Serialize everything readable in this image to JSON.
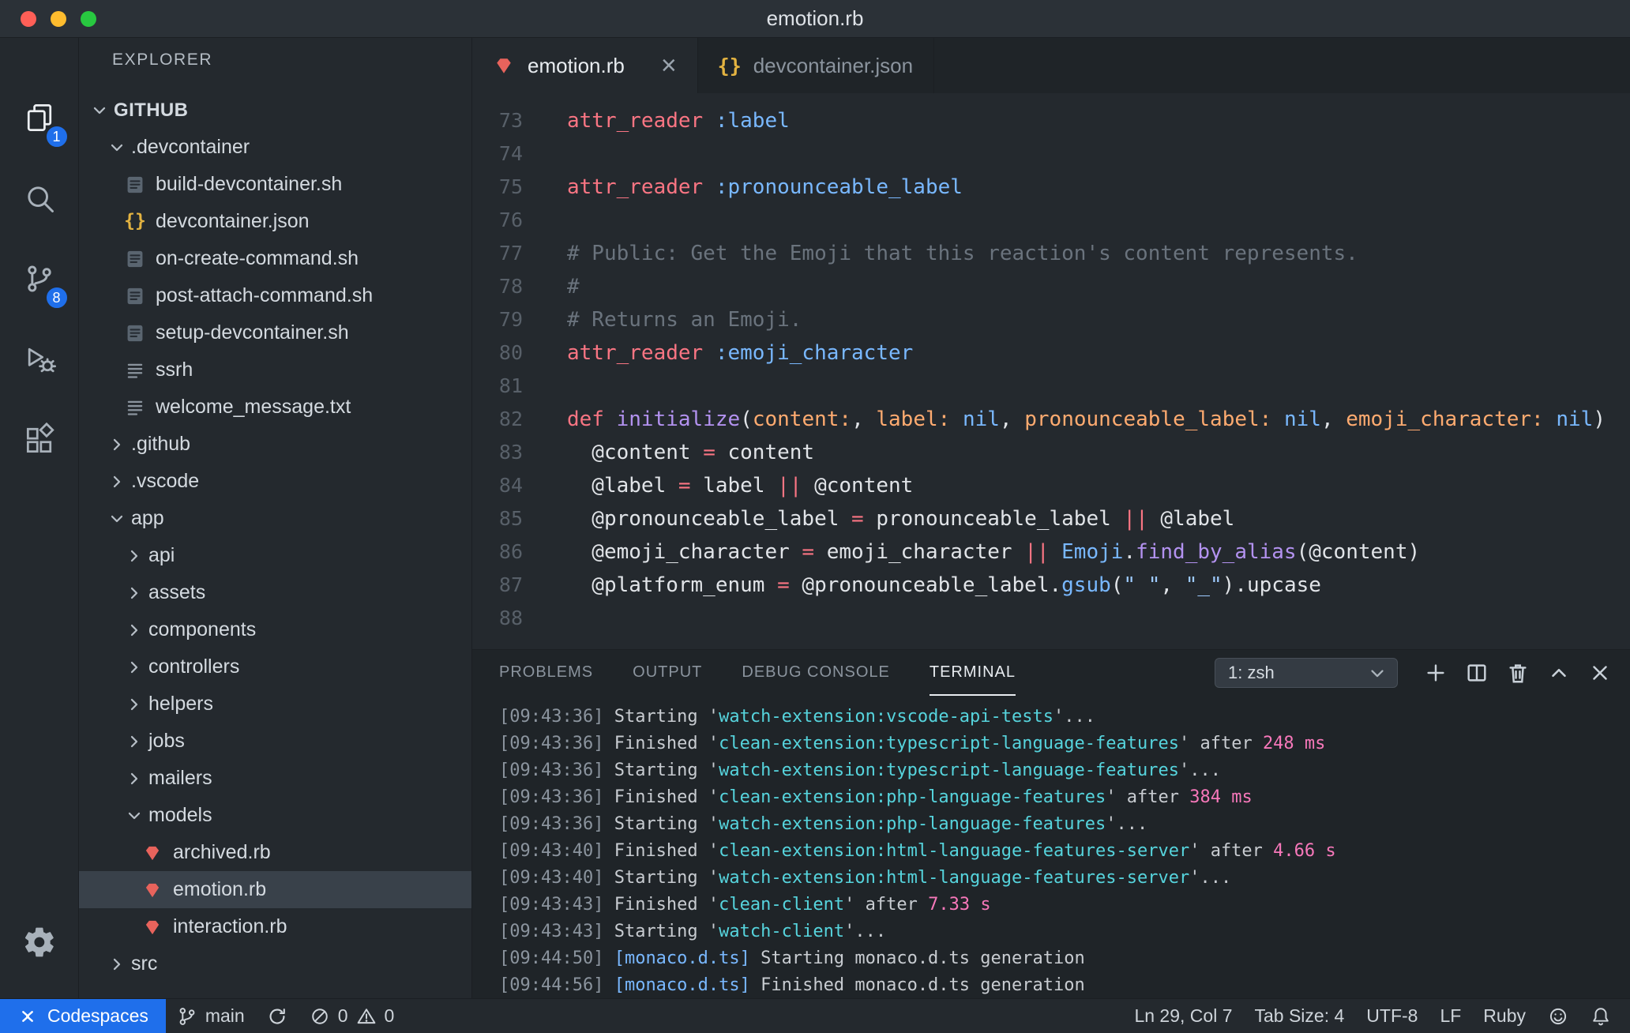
{
  "theme": {
    "accent_blue": "#1f6feb",
    "selection_bg": "#39414a",
    "editor_bg": "#24292e",
    "panel_bg": "#1f2428",
    "ruby_icon_color": "#e8635c",
    "json_icon_color": "#e3b341",
    "traffic_red": "#ff5f57",
    "traffic_yellow": "#febc2e",
    "traffic_green": "#28c840"
  },
  "title_bar": {
    "title": "emotion.rb"
  },
  "activity_bar": {
    "explorer_badge": "1",
    "source_control_badge": "8"
  },
  "explorer": {
    "header": "EXPLORER",
    "items": [
      {
        "label": "GITHUB",
        "depth": 0,
        "kind": "root",
        "expanded": true
      },
      {
        "label": ".devcontainer",
        "depth": 1,
        "kind": "folder",
        "expanded": true
      },
      {
        "label": "build-devcontainer.sh",
        "depth": 2,
        "kind": "file",
        "icon": "shell"
      },
      {
        "label": "devcontainer.json",
        "depth": 2,
        "kind": "file",
        "icon": "json"
      },
      {
        "label": "on-create-command.sh",
        "depth": 2,
        "kind": "file",
        "icon": "shell"
      },
      {
        "label": "post-attach-command.sh",
        "depth": 2,
        "kind": "file",
        "icon": "shell"
      },
      {
        "label": "setup-devcontainer.sh",
        "depth": 2,
        "kind": "file",
        "icon": "shell"
      },
      {
        "label": "ssrh",
        "depth": 2,
        "kind": "file",
        "icon": "text"
      },
      {
        "label": "welcome_message.txt",
        "depth": 2,
        "kind": "file",
        "icon": "text"
      },
      {
        "label": ".github",
        "depth": 1,
        "kind": "folder",
        "expanded": false
      },
      {
        "label": ".vscode",
        "depth": 1,
        "kind": "folder",
        "expanded": false
      },
      {
        "label": "app",
        "depth": 1,
        "kind": "folder",
        "expanded": true
      },
      {
        "label": "api",
        "depth": 2,
        "kind": "folder",
        "expanded": false
      },
      {
        "label": "assets",
        "depth": 2,
        "kind": "folder",
        "expanded": false
      },
      {
        "label": "components",
        "depth": 2,
        "kind": "folder",
        "expanded": false
      },
      {
        "label": "controllers",
        "depth": 2,
        "kind": "folder",
        "expanded": false
      },
      {
        "label": "helpers",
        "depth": 2,
        "kind": "folder",
        "expanded": false
      },
      {
        "label": "jobs",
        "depth": 2,
        "kind": "folder",
        "expanded": false
      },
      {
        "label": "mailers",
        "depth": 2,
        "kind": "folder",
        "expanded": false
      },
      {
        "label": "models",
        "depth": 2,
        "kind": "folder",
        "expanded": true
      },
      {
        "label": "archived.rb",
        "depth": 3,
        "kind": "file",
        "icon": "ruby"
      },
      {
        "label": "emotion.rb",
        "depth": 3,
        "kind": "file",
        "icon": "ruby",
        "selected": true
      },
      {
        "label": "interaction.rb",
        "depth": 3,
        "kind": "file",
        "icon": "ruby"
      },
      {
        "label": "src",
        "depth": 1,
        "kind": "folder",
        "expanded": false
      }
    ]
  },
  "editor_tabs": [
    {
      "label": "emotion.rb",
      "icon": "ruby",
      "active": true,
      "close_glyph": "×"
    },
    {
      "label": "devcontainer.json",
      "icon": "json",
      "active": false
    }
  ],
  "editor": {
    "line_number_color": "#586069",
    "syntax_colors": {
      "kw": "#f97583",
      "sym": "#79b8ff",
      "cmt": "#6a737d",
      "fn": "#b392f0",
      "param": "#ffab70",
      "const": "#79b8ff",
      "builtin": "#79b8ff",
      "str": "#9ecbff",
      "pln": "#e1e4e8"
    },
    "lines": [
      {
        "num": "73",
        "tokens": [
          [
            "kw",
            "attr_reader"
          ],
          [
            "pln",
            " "
          ],
          [
            "sym",
            ":label"
          ]
        ]
      },
      {
        "num": "74",
        "tokens": []
      },
      {
        "num": "75",
        "tokens": [
          [
            "kw",
            "attr_reader"
          ],
          [
            "pln",
            " "
          ],
          [
            "sym",
            ":pronounceable_label"
          ]
        ]
      },
      {
        "num": "76",
        "tokens": []
      },
      {
        "num": "77",
        "tokens": [
          [
            "cmt",
            "# Public: Get the Emoji that this reaction's content represents."
          ]
        ]
      },
      {
        "num": "78",
        "tokens": [
          [
            "cmt",
            "#"
          ]
        ]
      },
      {
        "num": "79",
        "tokens": [
          [
            "cmt",
            "# Returns an Emoji."
          ]
        ]
      },
      {
        "num": "80",
        "tokens": [
          [
            "kw",
            "attr_reader"
          ],
          [
            "pln",
            " "
          ],
          [
            "sym",
            ":emoji_character"
          ]
        ]
      },
      {
        "num": "81",
        "tokens": []
      },
      {
        "num": "82",
        "tokens": [
          [
            "kw",
            "def"
          ],
          [
            "pln",
            " "
          ],
          [
            "fn",
            "initialize"
          ],
          [
            "pln",
            "("
          ],
          [
            "param",
            "content:"
          ],
          [
            "pln",
            ", "
          ],
          [
            "param",
            "label:"
          ],
          [
            "pln",
            " "
          ],
          [
            "builtin",
            "nil"
          ],
          [
            "pln",
            ", "
          ],
          [
            "param",
            "pronounceable_label:"
          ],
          [
            "pln",
            " "
          ],
          [
            "builtin",
            "nil"
          ],
          [
            "pln",
            ", "
          ],
          [
            "param",
            "emoji_character:"
          ],
          [
            "pln",
            " "
          ],
          [
            "builtin",
            "nil"
          ],
          [
            "pln",
            ")"
          ]
        ]
      },
      {
        "num": "83",
        "tokens": [
          [
            "pln",
            "  @content "
          ],
          [
            "kw",
            "="
          ],
          [
            "pln",
            " content"
          ]
        ]
      },
      {
        "num": "84",
        "tokens": [
          [
            "pln",
            "  @label "
          ],
          [
            "kw",
            "="
          ],
          [
            "pln",
            " label "
          ],
          [
            "kw",
            "||"
          ],
          [
            "pln",
            " @content"
          ]
        ]
      },
      {
        "num": "85",
        "tokens": [
          [
            "pln",
            "  @pronounceable_label "
          ],
          [
            "kw",
            "="
          ],
          [
            "pln",
            " pronounceable_label "
          ],
          [
            "kw",
            "||"
          ],
          [
            "pln",
            " @label"
          ]
        ]
      },
      {
        "num": "86",
        "tokens": [
          [
            "pln",
            "  @emoji_character "
          ],
          [
            "kw",
            "="
          ],
          [
            "pln",
            " emoji_character "
          ],
          [
            "kw",
            "||"
          ],
          [
            "pln",
            " "
          ],
          [
            "const",
            "Emoji"
          ],
          [
            "pln",
            "."
          ],
          [
            "fn",
            "find_by_alias"
          ],
          [
            "pln",
            "(@content)"
          ]
        ]
      },
      {
        "num": "87",
        "tokens": [
          [
            "pln",
            "  @platform_enum "
          ],
          [
            "kw",
            "="
          ],
          [
            "pln",
            " @pronounceable_label."
          ],
          [
            "builtin",
            "gsub"
          ],
          [
            "pln",
            "("
          ],
          [
            "str",
            "\" \""
          ],
          [
            "pln",
            ", "
          ],
          [
            "str",
            "\"_\""
          ],
          [
            "pln",
            ").upcase"
          ]
        ]
      },
      {
        "num": "88",
        "tokens": []
      }
    ]
  },
  "panel": {
    "tabs": [
      "PROBLEMS",
      "OUTPUT",
      "DEBUG CONSOLE",
      "TERMINAL"
    ],
    "active_tab": "TERMINAL",
    "terminal_selector": "1: zsh",
    "terminal_colors": {
      "ts": "#8b949e",
      "pln": "#c8ccd1",
      "task": "#56d4dd",
      "dur": "#f778ba",
      "file": "#79b8ff"
    },
    "terminal_lines": [
      [
        [
          "ts",
          "[09:43:36] "
        ],
        [
          "pln",
          "Starting "
        ],
        [
          "pln",
          "'"
        ],
        [
          "task",
          "watch-extension:vscode-api-tests"
        ],
        [
          "pln",
          "'..."
        ]
      ],
      [
        [
          "ts",
          "[09:43:36] "
        ],
        [
          "pln",
          "Finished "
        ],
        [
          "pln",
          "'"
        ],
        [
          "task",
          "clean-extension:typescript-language-features"
        ],
        [
          "pln",
          "' after "
        ],
        [
          "dur",
          "248 ms"
        ]
      ],
      [
        [
          "ts",
          "[09:43:36] "
        ],
        [
          "pln",
          "Starting "
        ],
        [
          "pln",
          "'"
        ],
        [
          "task",
          "watch-extension:typescript-language-features"
        ],
        [
          "pln",
          "'..."
        ]
      ],
      [
        [
          "ts",
          "[09:43:36] "
        ],
        [
          "pln",
          "Finished "
        ],
        [
          "pln",
          "'"
        ],
        [
          "task",
          "clean-extension:php-language-features"
        ],
        [
          "pln",
          "' after "
        ],
        [
          "dur",
          "384 ms"
        ]
      ],
      [
        [
          "ts",
          "[09:43:36] "
        ],
        [
          "pln",
          "Starting "
        ],
        [
          "pln",
          "'"
        ],
        [
          "task",
          "watch-extension:php-language-features"
        ],
        [
          "pln",
          "'..."
        ]
      ],
      [
        [
          "ts",
          "[09:43:40] "
        ],
        [
          "pln",
          "Finished "
        ],
        [
          "pln",
          "'"
        ],
        [
          "task",
          "clean-extension:html-language-features-server"
        ],
        [
          "pln",
          "' after "
        ],
        [
          "dur",
          "4.66 s"
        ]
      ],
      [
        [
          "ts",
          "[09:43:40] "
        ],
        [
          "pln",
          "Starting "
        ],
        [
          "pln",
          "'"
        ],
        [
          "task",
          "watch-extension:html-language-features-server"
        ],
        [
          "pln",
          "'..."
        ]
      ],
      [
        [
          "ts",
          "[09:43:43] "
        ],
        [
          "pln",
          "Finished "
        ],
        [
          "pln",
          "'"
        ],
        [
          "task",
          "clean-client"
        ],
        [
          "pln",
          "' after "
        ],
        [
          "dur",
          "7.33 s"
        ]
      ],
      [
        [
          "ts",
          "[09:43:43] "
        ],
        [
          "pln",
          "Starting "
        ],
        [
          "pln",
          "'"
        ],
        [
          "task",
          "watch-client"
        ],
        [
          "pln",
          "'..."
        ]
      ],
      [
        [
          "ts",
          "[09:44:50] "
        ],
        [
          "file",
          "[monaco.d.ts]"
        ],
        [
          "pln",
          " Starting monaco.d.ts generation"
        ]
      ],
      [
        [
          "ts",
          "[09:44:56] "
        ],
        [
          "file",
          "[monaco.d.ts]"
        ],
        [
          "pln",
          " Finished monaco.d.ts generation"
        ]
      ]
    ]
  },
  "status_bar": {
    "codespaces_label": "Codespaces",
    "branch": "main",
    "error_count": "0",
    "warning_count": "0",
    "cursor_position": "Ln 29, Col 7",
    "tab_size": "Tab Size: 4",
    "encoding": "UTF-8",
    "eol": "LF",
    "language": "Ruby"
  }
}
